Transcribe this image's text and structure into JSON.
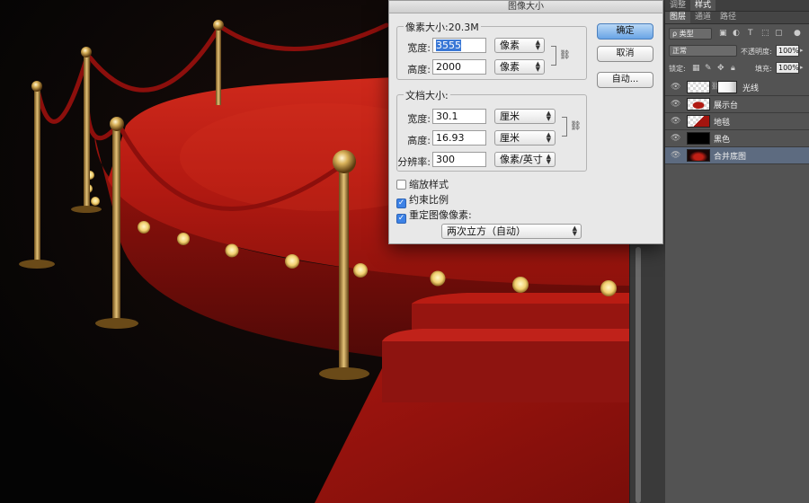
{
  "dialog": {
    "title": "图像大小",
    "pixel_dimensions": {
      "legend": "像素大小:20.3M",
      "width_label": "宽度:",
      "width_value": "3555",
      "width_unit": "像素",
      "height_label": "高度:",
      "height_value": "2000",
      "height_unit": "像素"
    },
    "document_size": {
      "legend": "文档大小:",
      "width_label": "宽度:",
      "width_value": "30.1",
      "width_unit": "厘米",
      "height_label": "高度:",
      "height_value": "16.93",
      "height_unit": "厘米",
      "resolution_label": "分辨率:",
      "resolution_value": "300",
      "resolution_unit": "像素/英寸"
    },
    "buttons": {
      "ok": "确定",
      "cancel": "取消",
      "auto": "自动..."
    },
    "checkboxes": [
      {
        "label": "缩放样式",
        "checked": false
      },
      {
        "label": "约束比例",
        "checked": true
      },
      {
        "label": "重定图像像素:",
        "checked": true
      }
    ],
    "resample_method": "两次立方（自动）"
  },
  "panel": {
    "top_tabs": [
      "调整",
      "样式"
    ],
    "tabs": [
      "图层",
      "通道",
      "路径"
    ],
    "filter_label": "ρ 类型",
    "blend_mode": "正常",
    "opacity_label": "不透明度:",
    "opacity_value": "100%",
    "lock_label": "锁定:",
    "fill_label": "填充:",
    "fill_value": "100%",
    "layers": [
      {
        "name": "光线",
        "thumb": "checker",
        "has_mask": true,
        "selected": false
      },
      {
        "name": "展示台",
        "thumb": "checker-red",
        "has_mask": false,
        "selected": false
      },
      {
        "name": "地毯",
        "thumb": "checker-red",
        "has_mask": false,
        "selected": false
      },
      {
        "name": "黑色",
        "thumb": "black",
        "has_mask": false,
        "selected": false
      },
      {
        "name": "合并底图",
        "thumb": "scene",
        "has_mask": false,
        "selected": true
      }
    ]
  },
  "colors": {
    "stage_red": "#a5140e",
    "rope_red": "#8c0f0c",
    "gold": "#d9b25a",
    "selection_blue": "#3a78d6"
  }
}
